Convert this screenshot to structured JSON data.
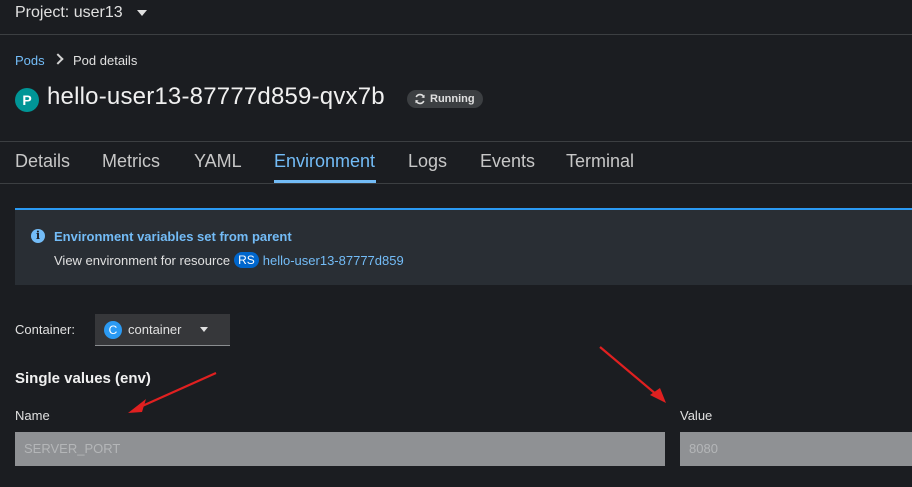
{
  "project": {
    "label": "Project: user13"
  },
  "breadcrumb": {
    "parent": "Pods",
    "current": "Pod details"
  },
  "pod": {
    "badge": "P",
    "name": "hello-user13-87777d859-qvx7b",
    "status": "Running"
  },
  "tabs": [
    {
      "label": "Details"
    },
    {
      "label": "Metrics"
    },
    {
      "label": "YAML"
    },
    {
      "label": "Environment",
      "active": true
    },
    {
      "label": "Logs"
    },
    {
      "label": "Events"
    },
    {
      "label": "Terminal"
    }
  ],
  "alert": {
    "icon": "info-icon",
    "title": "Environment variables set from parent",
    "text": "View environment for resource",
    "resource_badge": "RS",
    "resource_link": "hello-user13-87777d859"
  },
  "container": {
    "label": "Container:",
    "badge": "C",
    "value": "container"
  },
  "env": {
    "section_title": "Single values (env)",
    "name_header": "Name",
    "value_header": "Value",
    "rows": [
      {
        "name": "SERVER_PORT",
        "value": "8080"
      }
    ]
  },
  "colors": {
    "accent": "#73bcf7",
    "pod_badge": "#009596",
    "annotation_arrow": "#e02020"
  }
}
